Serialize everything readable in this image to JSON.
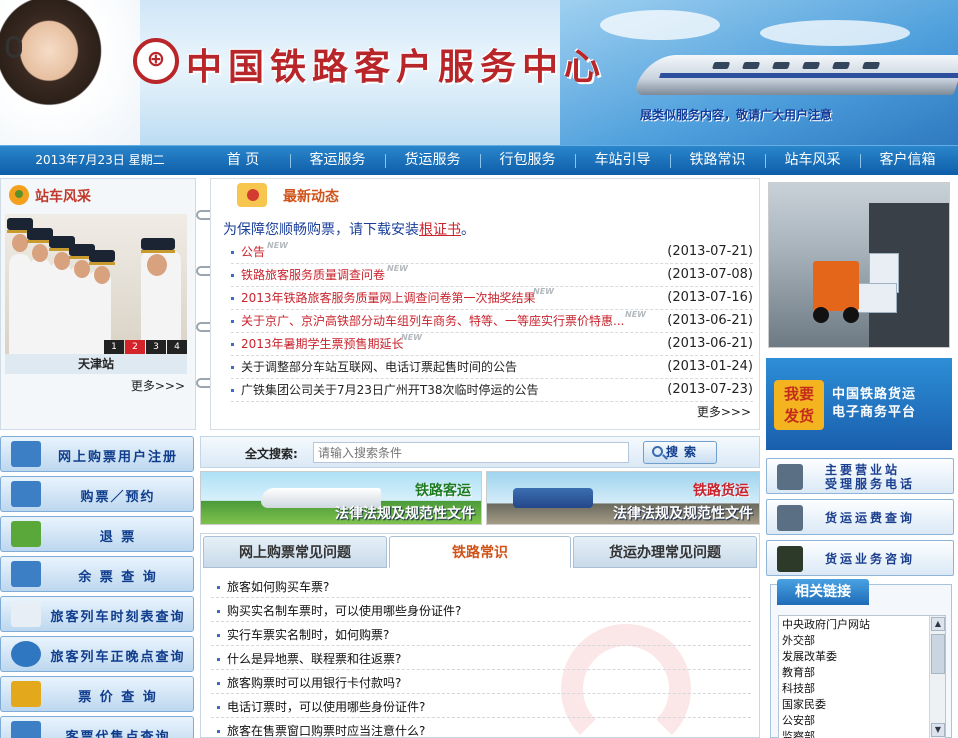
{
  "header": {
    "logo_mark": "⊕",
    "title": "中国铁路客户服务中心",
    "notice": "展类似服务内容，敬请广大用户注意"
  },
  "nav": {
    "date": "2013年7月23日 星期二",
    "items": [
      {
        "label": "首  页"
      },
      {
        "label": "客运服务"
      },
      {
        "label": "货运服务"
      },
      {
        "label": "行包服务"
      },
      {
        "label": "车站引导"
      },
      {
        "label": "铁路常识"
      },
      {
        "label": "站车风采"
      },
      {
        "label": "客户信箱"
      }
    ]
  },
  "station_panel": {
    "title": "站车风采",
    "caption": "天津站",
    "pages": [
      "1",
      "2",
      "3",
      "4"
    ],
    "active_page": "2",
    "more": "更多>>>"
  },
  "news_panel": {
    "title": "最新动态",
    "notice_text": "为保障您顺畅购票，请下载安装",
    "notice_link": "根证书",
    "notice_end": "。",
    "items": [
      {
        "title": "公告",
        "is_new": true,
        "new_label": "NEW",
        "date": "(2013-07-21)",
        "red": true
      },
      {
        "title": "铁路旅客服务质量调查问卷",
        "is_new": true,
        "new_label": "NEW",
        "date": "(2013-07-08)",
        "red": true
      },
      {
        "title": "2013年铁路旅客服务质量网上调查问卷第一次抽奖结果",
        "is_new": true,
        "new_label": "NEW",
        "date": "(2013-07-16)",
        "red": true
      },
      {
        "title": "关于京广、京沪高铁部分动车组列车商务、特等、一等座实行票价特惠...",
        "is_new": true,
        "new_label": "NEW",
        "date": "(2013-06-21)",
        "red": true
      },
      {
        "title": "2013年暑期学生票预售期延长",
        "is_new": true,
        "new_label": "NEW",
        "date": "(2013-06-21)",
        "red": true
      },
      {
        "title": "关于调整部分车站互联网、电话订票起售时间的公告",
        "is_new": false,
        "new_label": "",
        "date": "(2013-01-24)",
        "red": false
      },
      {
        "title": "广铁集团公司关于7月23日广州开T38次临时停运的公告",
        "is_new": false,
        "new_label": "",
        "date": "(2013-07-23)",
        "red": false
      }
    ],
    "more": "更多>>>"
  },
  "left_menu": [
    {
      "label": "网上购票用户注册",
      "icon": "user-register-icon"
    },
    {
      "label": "购票／预约",
      "icon": "ticket-icon"
    },
    {
      "label": "退    票",
      "icon": "refund-icon"
    },
    {
      "label": "余 票 查 询",
      "icon": "remaining-ticket-icon"
    },
    {
      "label": "旅客列车时刻表查询",
      "icon": "timetable-icon"
    },
    {
      "label": "旅客列车正晚点查询",
      "icon": "clock-icon"
    },
    {
      "label": "票 价 查 询",
      "icon": "price-icon"
    },
    {
      "label": "客票代售点查询",
      "icon": "agency-icon"
    }
  ],
  "search": {
    "label": "全文搜索:",
    "placeholder": "请输入搜索条件",
    "button": "搜索"
  },
  "promos": [
    {
      "line1": "铁路客运",
      "line2": "法律法规及规范性文件"
    },
    {
      "line1": "铁路货运",
      "line2": "法律法规及规范性文件"
    }
  ],
  "faq": {
    "tabs": [
      {
        "label": "网上购票常见问题"
      },
      {
        "label": "铁路常识"
      },
      {
        "label": "货运办理常见问题"
      }
    ],
    "active_tab": "铁路常识",
    "items": [
      "旅客如何购买车票?",
      "购买实名制车票时，可以使用哪些身份证件?",
      "实行车票实名制时，如何购票?",
      "什么是异地票、联程票和往返票?",
      "旅客购票时可以用银行卡付款吗?",
      "电话订票时，可以使用哪些身份证件?",
      "旅客在售票窗口购票时应当注意什么?"
    ]
  },
  "right_panel": {
    "ecom_badge_line1": "我要",
    "ecom_badge_line2": "发货",
    "ecom_line1": "中国铁路货运",
    "ecom_line2": "电子商务平台",
    "buttons": [
      {
        "line1": "主要营业站",
        "line2": "受理服务电话",
        "icon": "phone-icon"
      },
      {
        "line1": "货运运费查询",
        "line2": "",
        "icon": "calculator-icon"
      },
      {
        "line1": "货运业务咨询",
        "line2": "",
        "icon": "locomotive-icon"
      }
    ],
    "links_title": "相关链接",
    "links": [
      "中央政府门户网站",
      "外交部",
      "发展改革委",
      "教育部",
      "科技部",
      "国家民委",
      "公安部",
      "监察部"
    ]
  },
  "colors": {
    "brand_red": "#b8262a",
    "nav_blue": "#0d5ea8",
    "accent_orange": "#d0531a",
    "link_blue": "#1a3f9a"
  }
}
